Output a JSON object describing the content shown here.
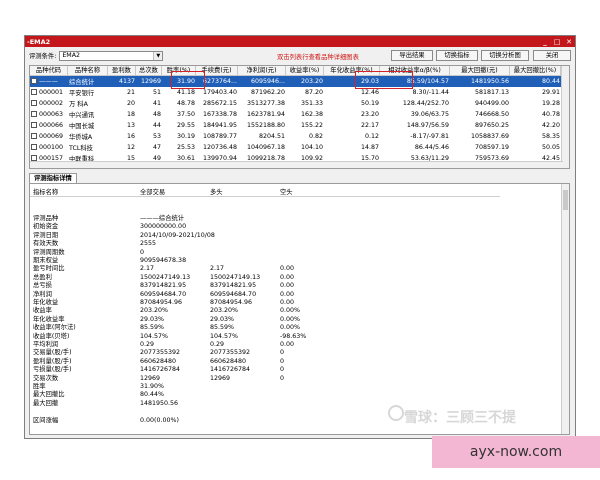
{
  "window": {
    "title": "-EMA2",
    "controls": [
      "_",
      "□",
      "✕"
    ]
  },
  "toolbar": {
    "condition_label": "评测条件:",
    "condition_value": "EMA2",
    "hint": "双击列表行查看品种详细图表",
    "buttons": [
      "导出结果",
      "切换指标",
      "切换分析图",
      "关闭"
    ]
  },
  "table": {
    "columns": [
      "品种代码",
      "品种名称",
      "盈利数",
      "总次数",
      "胜率(%)",
      "手续费(元)",
      "净利润(元)",
      "收益率(%)",
      "年化收益率(%)",
      "相对收益率α/β(%)",
      "最大回撤(元)",
      "最大回撤比(%)"
    ],
    "rows": [
      [
        "———",
        "综合统计",
        "4137",
        "12969",
        "31.90",
        "6273764...",
        "6095946...",
        "203.20",
        "29.03",
        "85.59/104.57",
        "1481950.56",
        "80.44"
      ],
      [
        "000001",
        "平安银行",
        "21",
        "51",
        "41.18",
        "179403.40",
        "871962.20",
        "87.20",
        "12.46",
        "8.30/-11.44",
        "581817.13",
        "29.91"
      ],
      [
        "000002",
        "万 科A",
        "20",
        "41",
        "48.78",
        "285672.15",
        "3513277.38",
        "351.33",
        "50.19",
        "128.44/252.70",
        "940499.00",
        "19.28"
      ],
      [
        "000063",
        "中兴通讯",
        "18",
        "48",
        "37.50",
        "167338.78",
        "1623781.94",
        "162.38",
        "23.20",
        "39.06/63.75",
        "746668.50",
        "40.78"
      ],
      [
        "000066",
        "中国长城",
        "13",
        "44",
        "29.55",
        "184941.95",
        "1552188.80",
        "155.22",
        "22.17",
        "148.97/56.59",
        "897650.25",
        "42.20"
      ],
      [
        "000069",
        "华侨城A",
        "16",
        "53",
        "30.19",
        "108789.77",
        "8204.51",
        "0.82",
        "0.12",
        "-8.17/-97.81",
        "1058837.69",
        "58.35"
      ],
      [
        "000100",
        "TCL科技",
        "12",
        "47",
        "25.53",
        "120736.48",
        "1040967.18",
        "104.10",
        "14.87",
        "86.44/5.46",
        "708597.19",
        "50.05"
      ],
      [
        "000157",
        "中联重科",
        "15",
        "49",
        "30.61",
        "139970.94",
        "1099218.78",
        "109.92",
        "15.70",
        "53.63/11.29",
        "759573.69",
        "42.45"
      ]
    ]
  },
  "detail_tab": "评测指标详情",
  "detail": {
    "headers": [
      "指标名称",
      "全部交易",
      "多头",
      "空头"
    ],
    "rows": [
      [
        "评测品种",
        "———综合统计",
        "",
        ""
      ],
      [
        "初始资金",
        "300000000.00",
        "",
        ""
      ],
      [
        "评测日期",
        "2014/10/09-2021/10/08",
        "",
        ""
      ],
      [
        "有效天数",
        "2555",
        "",
        ""
      ],
      [
        "评测周期数",
        "0",
        "",
        ""
      ],
      [
        "期末权益",
        "909594678.38",
        "",
        ""
      ],
      [
        "盈亏时间比",
        "2.17",
        "2.17",
        "0.00"
      ],
      [
        "总盈利",
        "1500247149.13",
        "1500247149.13",
        "0.00"
      ],
      [
        "总亏损",
        "837914821.95",
        "837914821.95",
        "0.00"
      ],
      [
        "净利润",
        "609594684.70",
        "609594684.70",
        "0.00"
      ],
      [
        "年化收益",
        "87084954.96",
        "87084954.96",
        "0.00"
      ],
      [
        "收益率",
        "203.20%",
        "203.20%",
        "0.00%"
      ],
      [
        "年化收益率",
        "29.03%",
        "29.03%",
        "0.00%"
      ],
      [
        "收益率(阿尔法)",
        "85.59%",
        "85.59%",
        "0.00%"
      ],
      [
        "收益率(贝塔)",
        "104.57%",
        "104.57%",
        "-98.63%"
      ],
      [
        "平均利润",
        "0.29",
        "0.29",
        "0.00"
      ],
      [
        "交易量(股/手)",
        "2077355392",
        "2077355392",
        "0"
      ],
      [
        "盈利量(股/手)",
        "660628480",
        "660628480",
        "0"
      ],
      [
        "亏损量(股/手)",
        "1416726784",
        "1416726784",
        "0"
      ],
      [
        "交易次数",
        "12969",
        "12969",
        "0"
      ],
      [
        "胜率",
        "31.90%",
        "",
        ""
      ],
      [
        "最大回撤比",
        "80.44%",
        "",
        ""
      ],
      [
        "最大回撤",
        "1481950.56",
        "",
        ""
      ],
      [
        "",
        "",
        "",
        ""
      ],
      [
        "区间涨幅",
        "0.00(0.00%)",
        "",
        ""
      ]
    ]
  },
  "watermark": "雪球：三顾三不提",
  "site_label": "ayx-now.com"
}
